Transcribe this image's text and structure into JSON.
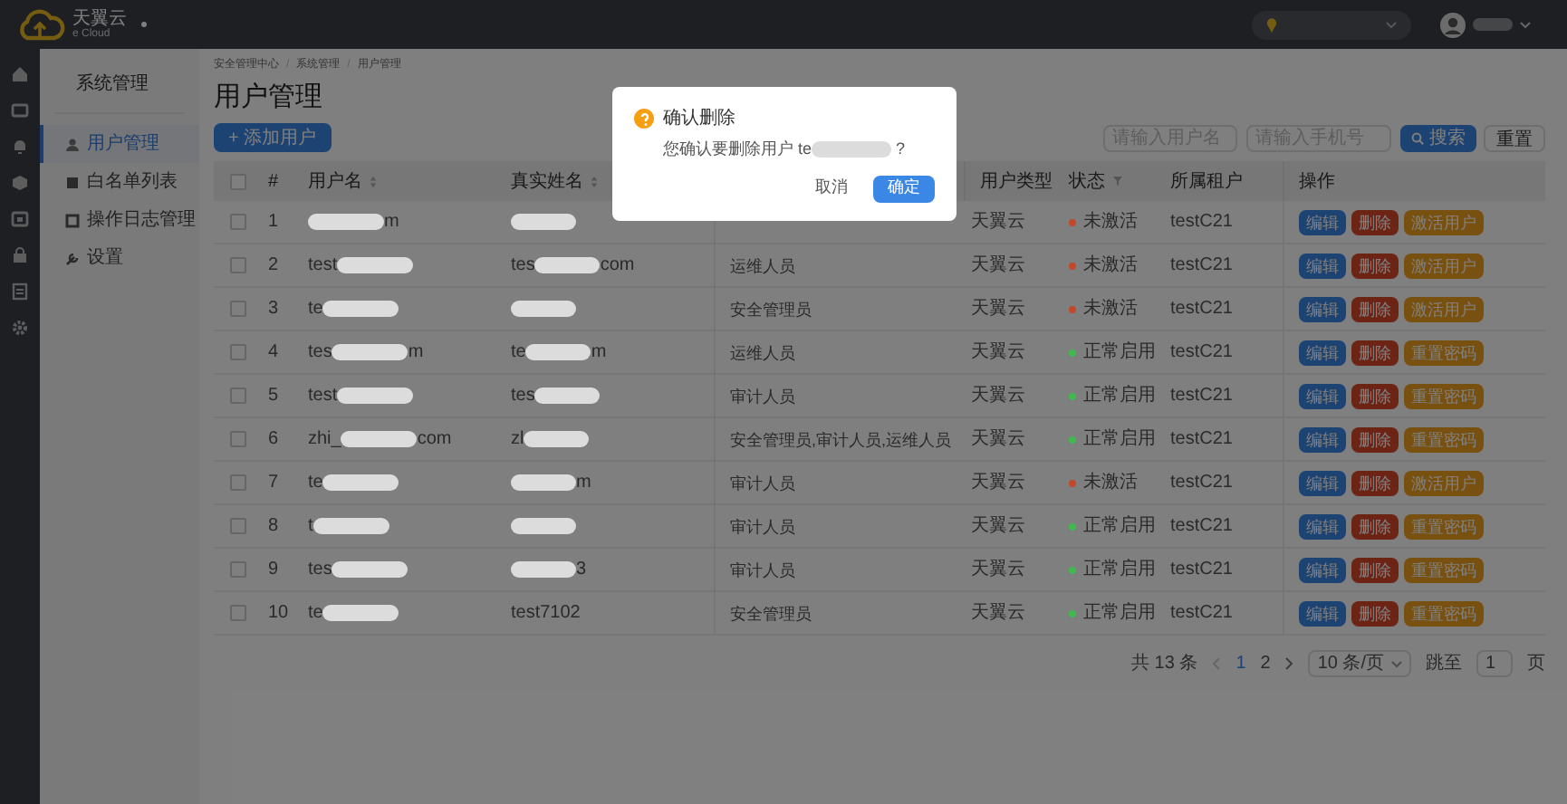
{
  "header": {
    "logo_title": "天翼云",
    "logo_subtitle": "e Cloud"
  },
  "sidebar": {
    "title": "系统管理",
    "items": [
      {
        "label": "用户管理",
        "selected": true
      },
      {
        "label": "白名单列表",
        "selected": false
      },
      {
        "label": "操作日志管理",
        "selected": false
      },
      {
        "label": "设置",
        "selected": false
      }
    ]
  },
  "breadcrumb": [
    {
      "kind": "link",
      "text": "安全管理中心"
    },
    {
      "kind": "separator",
      "text": "/"
    },
    {
      "kind": "link",
      "text": "系统管理"
    },
    {
      "kind": "separator",
      "text": "/"
    },
    {
      "kind": "link",
      "text": "用户管理"
    }
  ],
  "page_title": "用户管理",
  "add_button": "+ 添加用户",
  "filters": {
    "username_placeholder": "请输入用户名",
    "phone_placeholder": "请输入手机号",
    "search_button": "搜索",
    "reset_button": "重置"
  },
  "table": {
    "header_checked": false,
    "columns": [
      {
        "label": "#",
        "kind": "plain"
      },
      {
        "label": "用户名",
        "kind": "sort"
      },
      {
        "label": "真实姓名",
        "kind": "sort"
      },
      {
        "kind": "plain"
      },
      {
        "label": "用户类型",
        "kind": "plain"
      },
      {
        "label": "状态",
        "kind": "filter"
      },
      {
        "label": "所属租户",
        "kind": "plain"
      },
      {
        "label": "操作",
        "kind": "plain"
      }
    ],
    "rows": [
      {
        "checked": false,
        "index": "1",
        "username": [
          {
            "kind": "blob"
          },
          {
            "kind": "text",
            "text": "m"
          }
        ],
        "real_name": [
          {
            "kind": "blob"
          }
        ],
        "user_type": "天翼云",
        "status": {
          "label": "未激活",
          "color": "#c24a2a"
        },
        "tenant": "testC21",
        "actions": [
          {
            "label": "编辑",
            "kind": "edit"
          },
          {
            "label": "删除",
            "kind": "delete"
          },
          {
            "label": "激活用户",
            "kind": "extra"
          }
        ]
      },
      {
        "checked": false,
        "index": "2",
        "username": [
          {
            "kind": "text",
            "text": "test"
          },
          {
            "kind": "blob"
          }
        ],
        "real_name": [
          {
            "kind": "text",
            "text": "tes"
          },
          {
            "kind": "blob"
          },
          {
            "kind": "text",
            "text": "com"
          }
        ],
        "role": "运维人员",
        "user_type": "天翼云",
        "status": {
          "label": "未激活",
          "color": "#c24a2a"
        },
        "tenant": "testC21",
        "actions": [
          {
            "label": "编辑",
            "kind": "edit"
          },
          {
            "label": "删除",
            "kind": "delete"
          },
          {
            "label": "激活用户",
            "kind": "extra"
          }
        ]
      },
      {
        "checked": false,
        "index": "3",
        "username": [
          {
            "kind": "text",
            "text": "te"
          },
          {
            "kind": "blob"
          }
        ],
        "real_name": [
          {
            "kind": "blob"
          }
        ],
        "role": "安全管理员",
        "user_type": "天翼云",
        "status": {
          "label": "未激活",
          "color": "#c24a2a"
        },
        "tenant": "testC21",
        "actions": [
          {
            "label": "编辑",
            "kind": "edit"
          },
          {
            "label": "删除",
            "kind": "delete"
          },
          {
            "label": "激活用户",
            "kind": "extra"
          }
        ]
      },
      {
        "checked": false,
        "index": "4",
        "username": [
          {
            "kind": "text",
            "text": "tes"
          },
          {
            "kind": "blob"
          },
          {
            "kind": "text",
            "text": "m"
          }
        ],
        "real_name": [
          {
            "kind": "text",
            "text": "te"
          },
          {
            "kind": "blob"
          },
          {
            "kind": "text",
            "text": "m"
          }
        ],
        "role": "运维人员",
        "user_type": "天翼云",
        "status": {
          "label": "正常启用",
          "color": "#3fb950"
        },
        "tenant": "testC21",
        "actions": [
          {
            "label": "编辑",
            "kind": "edit"
          },
          {
            "label": "删除",
            "kind": "delete"
          },
          {
            "label": "重置密码",
            "kind": "extra"
          }
        ]
      },
      {
        "checked": false,
        "index": "5",
        "username": [
          {
            "kind": "text",
            "text": "test"
          },
          {
            "kind": "blob"
          }
        ],
        "real_name": [
          {
            "kind": "text",
            "text": "tes"
          },
          {
            "kind": "blob"
          }
        ],
        "role": "审计人员",
        "user_type": "天翼云",
        "status": {
          "label": "正常启用",
          "color": "#3fb950"
        },
        "tenant": "testC21",
        "actions": [
          {
            "label": "编辑",
            "kind": "edit"
          },
          {
            "label": "删除",
            "kind": "delete"
          },
          {
            "label": "重置密码",
            "kind": "extra"
          }
        ]
      },
      {
        "checked": false,
        "index": "6",
        "username": [
          {
            "kind": "text",
            "text": "zhi_"
          },
          {
            "kind": "blob"
          },
          {
            "kind": "text",
            "text": "com"
          }
        ],
        "real_name": [
          {
            "kind": "text",
            "text": "zl"
          },
          {
            "kind": "blob"
          }
        ],
        "role": "安全管理员,审计人员,运维人员",
        "user_type": "天翼云",
        "status": {
          "label": "正常启用",
          "color": "#3fb950"
        },
        "tenant": "testC21",
        "actions": [
          {
            "label": "编辑",
            "kind": "edit"
          },
          {
            "label": "删除",
            "kind": "delete"
          },
          {
            "label": "重置密码",
            "kind": "extra"
          }
        ]
      },
      {
        "checked": false,
        "index": "7",
        "username": [
          {
            "kind": "text",
            "text": "te"
          },
          {
            "kind": "blob"
          }
        ],
        "real_name": [
          {
            "kind": "blob"
          },
          {
            "kind": "text",
            "text": "m"
          }
        ],
        "role": "审计人员",
        "user_type": "天翼云",
        "status": {
          "label": "未激活",
          "color": "#c24a2a"
        },
        "tenant": "testC21",
        "actions": [
          {
            "label": "编辑",
            "kind": "edit"
          },
          {
            "label": "删除",
            "kind": "delete"
          },
          {
            "label": "激活用户",
            "kind": "extra"
          }
        ]
      },
      {
        "checked": false,
        "index": "8",
        "username": [
          {
            "kind": "text",
            "text": "t"
          },
          {
            "kind": "blob"
          }
        ],
        "real_name": [
          {
            "kind": "blob"
          }
        ],
        "role": "审计人员",
        "user_type": "天翼云",
        "status": {
          "label": "正常启用",
          "color": "#3fb950"
        },
        "tenant": "testC21",
        "actions": [
          {
            "label": "编辑",
            "kind": "edit"
          },
          {
            "label": "删除",
            "kind": "delete"
          },
          {
            "label": "重置密码",
            "kind": "extra"
          }
        ]
      },
      {
        "checked": false,
        "index": "9",
        "username": [
          {
            "kind": "text",
            "text": "tes"
          },
          {
            "kind": "blob"
          }
        ],
        "real_name": [
          {
            "kind": "blob"
          },
          {
            "kind": "text",
            "text": "3"
          }
        ],
        "role": "审计人员",
        "user_type": "天翼云",
        "status": {
          "label": "正常启用",
          "color": "#3fb950"
        },
        "tenant": "testC21",
        "actions": [
          {
            "label": "编辑",
            "kind": "edit"
          },
          {
            "label": "删除",
            "kind": "delete"
          },
          {
            "label": "重置密码",
            "kind": "extra"
          }
        ]
      },
      {
        "checked": false,
        "index": "10",
        "username": [
          {
            "kind": "text",
            "text": "te"
          },
          {
            "kind": "blob"
          }
        ],
        "real_name": [
          {
            "kind": "text",
            "text": "test7102"
          }
        ],
        "role": "安全管理员",
        "user_type": "天翼云",
        "status": {
          "label": "正常启用",
          "color": "#3fb950"
        },
        "tenant": "testC21",
        "actions": [
          {
            "label": "编辑",
            "kind": "edit"
          },
          {
            "label": "删除",
            "kind": "delete"
          },
          {
            "label": "重置密码",
            "kind": "extra"
          }
        ]
      }
    ]
  },
  "pagination": {
    "total": "共 13 条",
    "pages": [
      {
        "label": "1",
        "selected": true
      },
      {
        "label": "2",
        "selected": false
      }
    ],
    "page_size": "10 条/页",
    "jump_label": "跳至",
    "jump_value": "1",
    "jump_suffix": "页"
  },
  "dialog": {
    "title": "确认删除",
    "message": [
      {
        "kind": "text",
        "text": "您确认要删除用户 te"
      },
      {
        "kind": "blob"
      },
      {
        "kind": "text",
        "text": " ?"
      }
    ],
    "cancel": "取消",
    "confirm": "确定"
  }
}
